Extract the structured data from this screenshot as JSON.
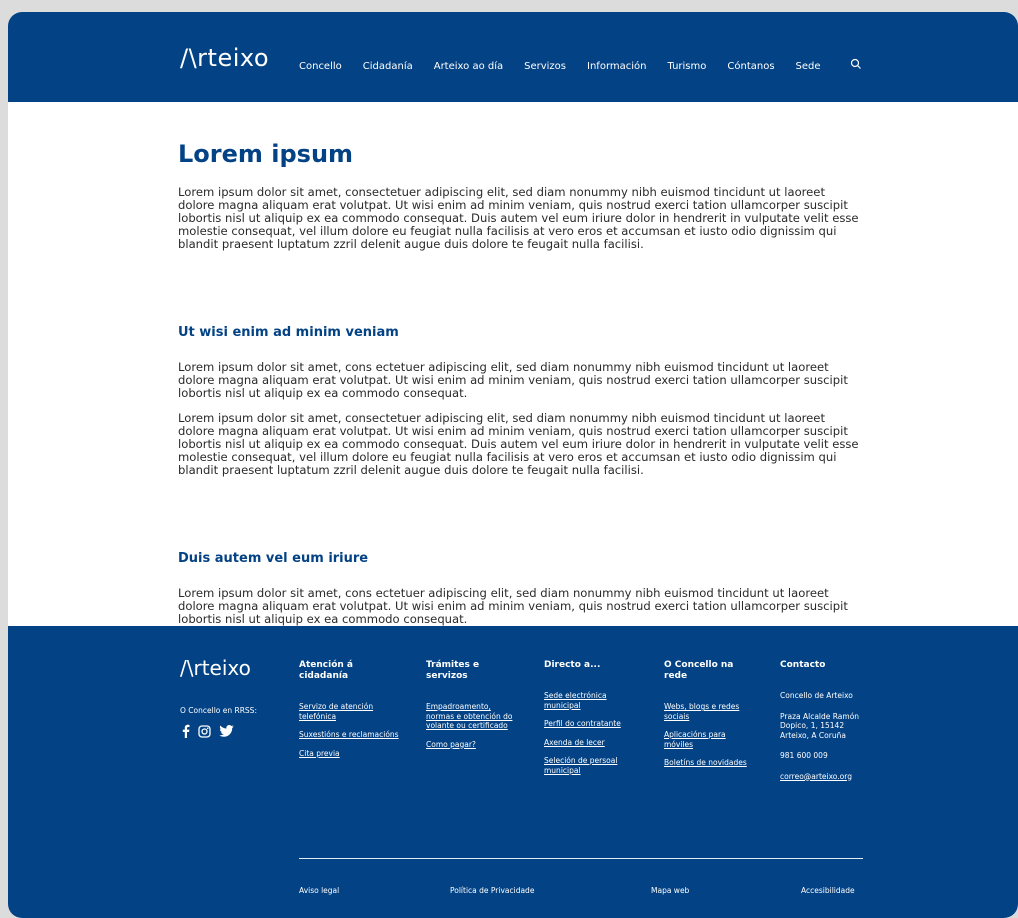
{
  "header": {
    "logo": "/\\rteixo",
    "nav": [
      "Concello",
      "Cidadanía",
      "Arteixo ao día",
      "Servizos",
      "Información",
      "Turismo",
      "Cóntanos",
      "Sede"
    ]
  },
  "main": {
    "title": "Lorem ipsum",
    "intro": "Lorem ipsum dolor sit amet, consectetuer adipiscing elit, sed diam nonummy nibh euismod tincidunt ut laoreet dolore magna aliquam erat volutpat. Ut wisi enim ad minim veniam, quis nostrud exerci tation ullamcorper suscipit lobortis nisl ut aliquip ex ea commodo consequat. Duis autem vel eum iriure dolor in hendrerit in vulputate velit esse molestie consequat, vel illum dolore eu feugiat nulla facilisis at vero eros et accumsan et iusto odio dignissim qui blandit praesent luptatum zzril delenit augue duis dolore te feugait nulla facilisi.",
    "section1_heading": "Ut wisi enim ad minim veniam",
    "section1_p1": "Lorem ipsum dolor sit amet, cons ectetuer adipiscing elit, sed diam nonummy nibh euismod tincidunt ut laoreet dolore magna aliquam erat volutpat. Ut wisi enim ad minim veniam, quis nostrud exerci tation ullamcorper suscipit lobortis nisl ut aliquip ex ea commodo consequat.",
    "section1_p2": "Lorem ipsum dolor sit amet, consectetuer adipiscing elit, sed diam nonummy nibh euismod tincidunt ut laoreet dolore magna aliquam erat volutpat. Ut wisi enim ad minim veniam, quis nostrud exerci tation ullamcorper suscipit lobortis nisl ut aliquip ex ea commodo consequat. Duis autem vel eum iriure dolor in hendrerit in vulputate velit esse molestie consequat, vel illum dolore eu feugiat nulla facilisis at vero eros et accumsan et iusto odio dignissim qui blandit praesent luptatum zzril delenit augue duis dolore te feugait nulla facilisi.",
    "section2_heading": "Duis autem vel eum iriure",
    "section2_p1": "Lorem ipsum dolor sit amet, cons ectetuer adipiscing elit, sed diam nonummy nibh euismod tincidunt ut laoreet dolore magna aliquam erat volutpat. Ut wisi enim ad minim veniam, quis nostrud exerci tation ullamcorper suscipit lobortis nisl ut aliquip ex ea commodo consequat."
  },
  "footer": {
    "logo": "/\\rteixo",
    "rrss_label": "O Concello en RRSS:",
    "columns": [
      {
        "title": "Atención á cidadanía",
        "links": [
          "Servizo de atención telefónica",
          "Suxestións e reclamacións",
          "Cita previa"
        ]
      },
      {
        "title": "Trámites e servizos",
        "links": [
          "Empadroamento, normas e obtención do volante ou certificado",
          "Como pagar?"
        ]
      },
      {
        "title": "Directo a...",
        "links": [
          "Sede electrónica municipal",
          "Perfil do contratante",
          "Axenda de lecer",
          "Seleción de persoal municipal"
        ]
      },
      {
        "title": "O Concello na rede",
        "links": [
          "Webs, blogs e redes sociais",
          "Aplicacións para móviles",
          "Boletíns de novidades"
        ]
      }
    ],
    "contact": {
      "title": "Contacto",
      "name": "Concello de Arteixo",
      "address": "Praza Alcalde Ramón Dopico, 1, 15142 Arteixo, A Coruña",
      "phone": "981 600 009",
      "email": "correo@arteixo.org"
    },
    "bottom": [
      "Aviso legal",
      "Política de Privacidade",
      "Mapa web",
      "Accesibilidade"
    ]
  },
  "colors": {
    "brand": "#034284"
  }
}
